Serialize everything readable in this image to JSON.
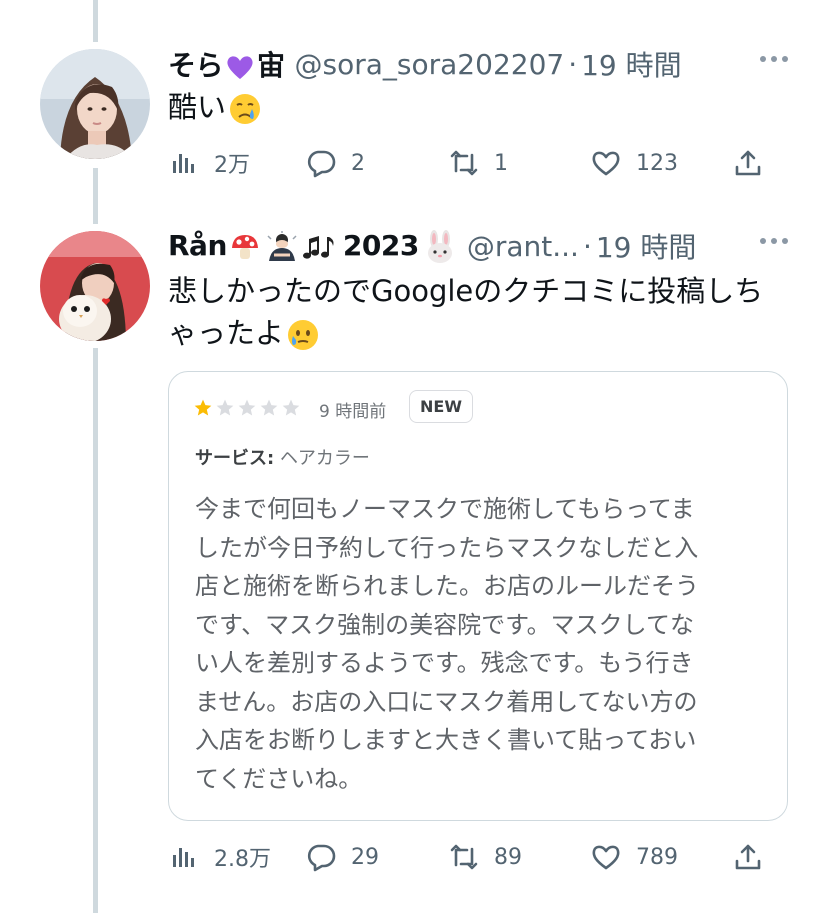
{
  "tweets": [
    {
      "name": "そら",
      "name_suffix": "宙",
      "handle": "@sora_sora202207",
      "separator": "·",
      "time": "19 時間",
      "text": "酷い",
      "views": "2万",
      "replies": "2",
      "retweets": "1",
      "likes": "123"
    },
    {
      "name": "Rån",
      "name_suffix": "2023",
      "handle": "@rant...",
      "separator": "·",
      "time": "19 時間",
      "text_line1": "悲しかったのでGoogleのクチコミに投稿しち",
      "text_line2": "ゃったよ",
      "views": "2.8万",
      "replies": "29",
      "retweets": "89",
      "likes": "789",
      "review": {
        "rating": 1,
        "max_rating": 5,
        "ago": "9 時間前",
        "badge": "NEW",
        "service_label": "サービス:",
        "service_value": "ヘアカラー",
        "lines": [
          "今まで何回もノーマスクで施術してもらってま",
          "したが今日予約して行ったらマスクなしだと入",
          "店と施術を断られました。お店のルールだそう",
          "です、マスク強制の美容院です。マスクしてな",
          "い人を差別するようです。残念です。もう行き",
          "ません。お店の入口にマスク着用してない方の",
          "入店をお断りしますと大きく書いて貼っておい",
          "てくださいね。"
        ]
      }
    }
  ],
  "colors": {
    "text": "#0f1419",
    "secondary": "#536471",
    "thread_line": "#cfd9de",
    "star_filled": "#fbbc04",
    "star_empty": "#dadce0"
  },
  "icons": [
    "views-icon",
    "reply-icon",
    "retweet-icon",
    "like-icon",
    "share-icon",
    "more-icon",
    "purple-heart-emoji",
    "crying-face-emoji",
    "mushroom-emoji",
    "person-bowing-emoji",
    "musical-notes-emoji",
    "rabbit-emoji",
    "face-holding-back-tears-emoji"
  ]
}
